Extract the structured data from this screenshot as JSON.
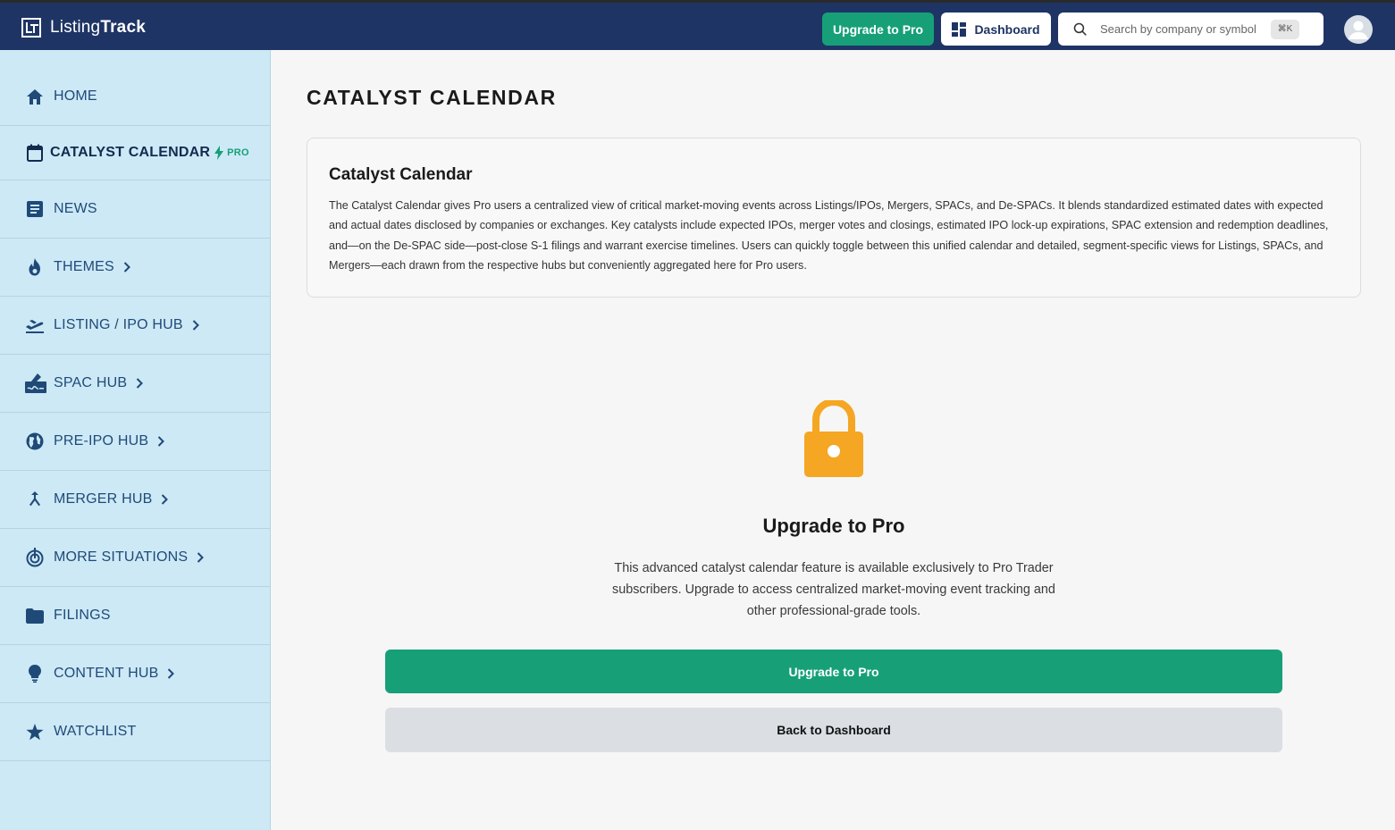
{
  "header": {
    "logo_light": "Listing",
    "logo_bold": "Track",
    "upgrade_label": "Upgrade to Pro",
    "dashboard_label": "Dashboard",
    "search_placeholder": "Search by company or symbol",
    "search_shortcut": "⌘K",
    "colors": {
      "bar": "#1e3464",
      "accent": "#17a078"
    }
  },
  "sidebar": {
    "items": [
      {
        "label": "HOME",
        "icon": "home-icon"
      },
      {
        "label": "CATALYST CALENDAR",
        "icon": "calendar-icon",
        "badge": "PRO",
        "active": true
      },
      {
        "label": "NEWS",
        "icon": "news-icon"
      },
      {
        "label": "THEMES",
        "icon": "flame-icon",
        "chevron": true
      },
      {
        "label": "LISTING / IPO HUB",
        "icon": "plane-takeoff-icon",
        "chevron": true
      },
      {
        "label": "SPAC HUB",
        "icon": "signature-icon",
        "chevron": true
      },
      {
        "label": "PRE-IPO HUB",
        "icon": "globe-icon",
        "chevron": true
      },
      {
        "label": "MERGER HUB",
        "icon": "merge-icon",
        "chevron": true
      },
      {
        "label": "MORE SITUATIONS",
        "icon": "target-icon",
        "chevron": true
      },
      {
        "label": "FILINGS",
        "icon": "folder-icon"
      },
      {
        "label": "CONTENT HUB",
        "icon": "lightbulb-icon",
        "chevron": true
      },
      {
        "label": "WATCHLIST",
        "icon": "star-icon"
      }
    ]
  },
  "main": {
    "page_title": "CATALYST CALENDAR",
    "card_title": "Catalyst Calendar",
    "card_body": "The Catalyst Calendar gives Pro users a centralized view of critical market-moving events across Listings/IPOs, Mergers, SPACs, and De-SPACs. It blends standardized estimated dates with expected and actual dates disclosed by companies or exchanges. Key catalysts include expected IPOs, merger votes and closings, estimated IPO lock-up expirations, SPAC extension and redemption deadlines, and—on the De-SPAC side—post-close S-1 filings and warrant exercise timelines. Users can quickly toggle between this unified calendar and detailed, segment-specific views for Listings, SPACs, and Mergers—each drawn from the respective hubs but conveniently aggregated here for Pro users.",
    "lock_title": "Upgrade to Pro",
    "lock_desc": "This advanced catalyst calendar feature is available exclusively to Pro Trader subscribers. Upgrade to access centralized market-moving event tracking and other professional-grade tools.",
    "upgrade_button": "Upgrade to Pro",
    "back_button": "Back to Dashboard",
    "lock_color": "#f5a623"
  }
}
